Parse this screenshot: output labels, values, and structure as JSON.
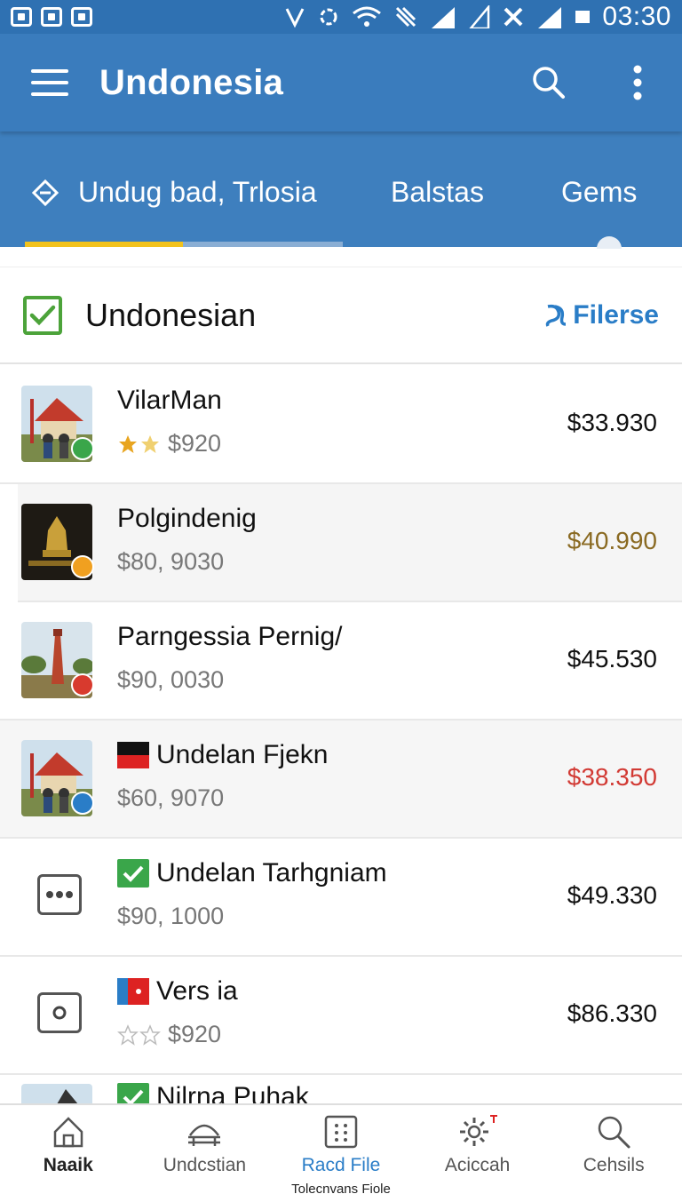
{
  "status_bar": {
    "time": "03:30"
  },
  "app_bar": {
    "title": "Undonesia",
    "icons": [
      "menu-icon",
      "search-icon",
      "more-vert-icon"
    ]
  },
  "tabs": [
    {
      "label": "Undug bad, Trlosia",
      "icon": "diamond-icon",
      "active": true
    },
    {
      "label": "Balstas"
    },
    {
      "label": "Gems"
    }
  ],
  "section": {
    "title": "Undonesian",
    "filter_label": "Filerse",
    "checked": true
  },
  "items": [
    {
      "name": "VilarMan",
      "sub": "$920",
      "price": "$33.930",
      "rating": 2,
      "price_color": "#111111",
      "badge_color": "#3aa64a"
    },
    {
      "name": "Polgindenig",
      "sub": "$80, 9030",
      "price": "$40.990",
      "price_color": "#8a6a22",
      "badge_color": "#f0a020"
    },
    {
      "name": "Parngessia Pernig/",
      "sub": "$90, 0030",
      "price": "$45.530",
      "price_color": "#111111",
      "badge_color": "#d83a2e"
    },
    {
      "name": "Undelan Fjekn",
      "sub": "$60, 9070",
      "price": "$38.350",
      "price_color": "#d23a34",
      "badge_color": "#2a7dc7"
    },
    {
      "name": "Undelan Tarhgniam",
      "sub": "$90, 1000",
      "price": "$49.330",
      "price_color": "#111111"
    },
    {
      "name": "Vers ia",
      "sub": "$920",
      "price": "$86.330",
      "rating": 0,
      "price_color": "#111111"
    },
    {
      "name": "Nilrna Puhak"
    }
  ],
  "bottom_nav": [
    {
      "label": "Naaik",
      "icon": "home-icon"
    },
    {
      "label": "Undcstian",
      "icon": "dome-icon"
    },
    {
      "label": "Racd File",
      "icon": "grid-icon",
      "sub": "Tolecnvans Fiole",
      "active": true
    },
    {
      "label": "Aciccah",
      "icon": "settings-icon"
    },
    {
      "label": "Cehsils",
      "icon": "search-icon"
    }
  ]
}
